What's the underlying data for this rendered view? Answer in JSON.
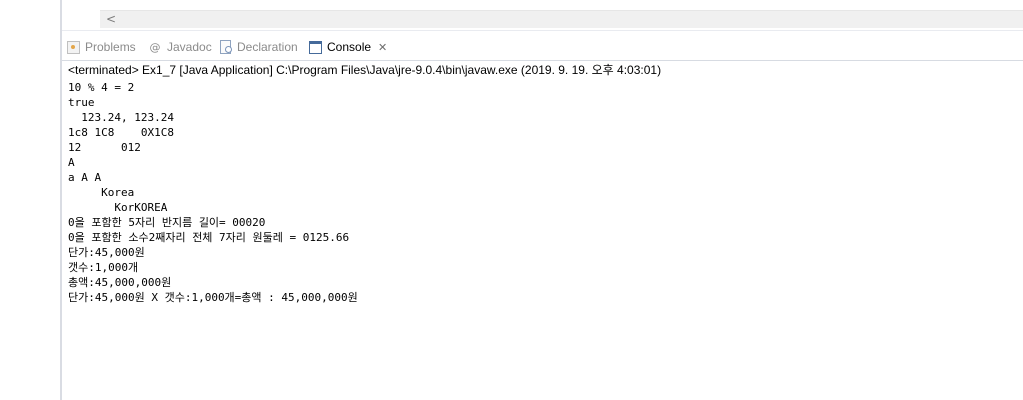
{
  "editor": {
    "scroll_left_arrow": "<"
  },
  "tabs": [
    {
      "label": "Problems",
      "icon": "problems-icon"
    },
    {
      "label": "Javadoc",
      "icon": "at-icon"
    },
    {
      "label": "Declaration",
      "icon": "declaration-icon"
    },
    {
      "label": "Console",
      "icon": "console-icon",
      "active": true,
      "close": "close-icon"
    }
  ],
  "console": {
    "header": "<terminated> Ex1_7 [Java Application] C:\\Program Files\\Java\\jre-9.0.4\\bin\\javaw.exe (2019. 9. 19. 오후 4:03:01)",
    "lines": [
      "10 % 4 = 2",
      "true",
      "  123.24, 123.24",
      "1c8 1C8    0X1C8",
      "12      012",
      "A",
      "a A A",
      "     Korea",
      "       KorKOREA",
      "0을 포함한 5자리 반지름 길이= 00020",
      "0을 포함한 소수2째자리 전체 7자리 원둘레 = 0125.66",
      "단가:45,000원",
      "갯수:1,000개",
      "총액:45,000,000원",
      "단가:45,000원 X 갯수:1,000개=총액 : 45,000,000원"
    ]
  }
}
